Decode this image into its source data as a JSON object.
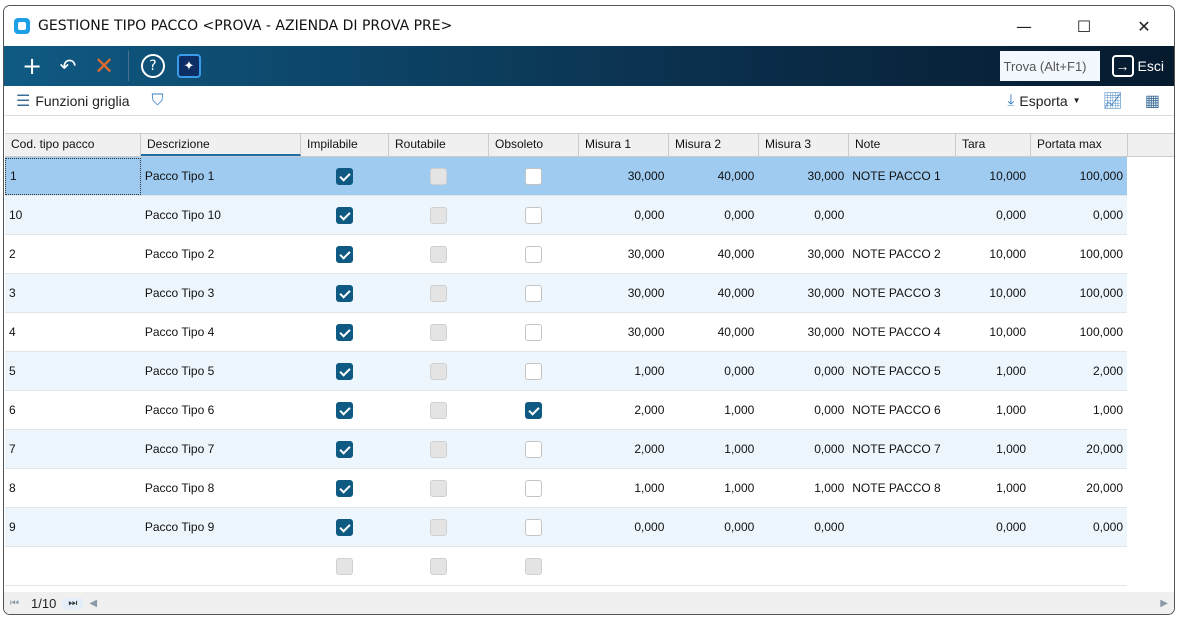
{
  "window": {
    "title": "GESTIONE TIPO PACCO <PROVA - AZIENDA DI PROVA PRE>",
    "minimize": "—",
    "maximize": "☐",
    "close": "✕"
  },
  "toolbar": {
    "find_placeholder": "Trova (Alt+F1)",
    "exit_label": "Esci"
  },
  "actions": {
    "grid_functions": "Funzioni griglia",
    "export": "Esporta"
  },
  "columns": [
    "Cod. tipo pacco",
    "Descrizione",
    "Impilabile",
    "Routabile",
    "Obsoleto",
    "Misura 1",
    "Misura 2",
    "Misura 3",
    "Note",
    "Tara",
    "Portata max"
  ],
  "rows": [
    {
      "cod": "1",
      "desc": "Pacco Tipo 1",
      "imp": true,
      "rout": false,
      "obs": false,
      "m1": "30,000",
      "m2": "40,000",
      "m3": "30,000",
      "note": "NOTE PACCO 1",
      "tara": "10,000",
      "portata": "100,000"
    },
    {
      "cod": "10",
      "desc": "Pacco Tipo 10",
      "imp": true,
      "rout": false,
      "obs": false,
      "m1": "0,000",
      "m2": "0,000",
      "m3": "0,000",
      "note": "",
      "tara": "0,000",
      "portata": "0,000"
    },
    {
      "cod": "2",
      "desc": "Pacco Tipo 2",
      "imp": true,
      "rout": false,
      "obs": false,
      "m1": "30,000",
      "m2": "40,000",
      "m3": "30,000",
      "note": "NOTE PACCO 2",
      "tara": "10,000",
      "portata": "100,000"
    },
    {
      "cod": "3",
      "desc": "Pacco Tipo 3",
      "imp": true,
      "rout": false,
      "obs": false,
      "m1": "30,000",
      "m2": "40,000",
      "m3": "30,000",
      "note": "NOTE PACCO 3",
      "tara": "10,000",
      "portata": "100,000"
    },
    {
      "cod": "4",
      "desc": "Pacco Tipo 4",
      "imp": true,
      "rout": false,
      "obs": false,
      "m1": "30,000",
      "m2": "40,000",
      "m3": "30,000",
      "note": "NOTE PACCO 4",
      "tara": "10,000",
      "portata": "100,000"
    },
    {
      "cod": "5",
      "desc": "Pacco Tipo 5",
      "imp": true,
      "rout": false,
      "obs": false,
      "m1": "1,000",
      "m2": "0,000",
      "m3": "0,000",
      "note": "NOTE PACCO 5",
      "tara": "1,000",
      "portata": "2,000"
    },
    {
      "cod": "6",
      "desc": "Pacco Tipo 6",
      "imp": true,
      "rout": false,
      "obs": true,
      "m1": "2,000",
      "m2": "1,000",
      "m3": "0,000",
      "note": "NOTE PACCO 6",
      "tara": "1,000",
      "portata": "1,000"
    },
    {
      "cod": "7",
      "desc": "Pacco Tipo 7",
      "imp": true,
      "rout": false,
      "obs": false,
      "m1": "2,000",
      "m2": "1,000",
      "m3": "0,000",
      "note": "NOTE PACCO 7",
      "tara": "1,000",
      "portata": "20,000"
    },
    {
      "cod": "8",
      "desc": "Pacco Tipo 8",
      "imp": true,
      "rout": false,
      "obs": false,
      "m1": "1,000",
      "m2": "1,000",
      "m3": "1,000",
      "note": "NOTE PACCO 8",
      "tara": "1,000",
      "portata": "20,000"
    },
    {
      "cod": "9",
      "desc": "Pacco Tipo 9",
      "imp": true,
      "rout": false,
      "obs": false,
      "m1": "0,000",
      "m2": "0,000",
      "m3": "0,000",
      "note": "",
      "tara": "0,000",
      "portata": "0,000"
    }
  ],
  "pager": {
    "page": "1/10"
  }
}
